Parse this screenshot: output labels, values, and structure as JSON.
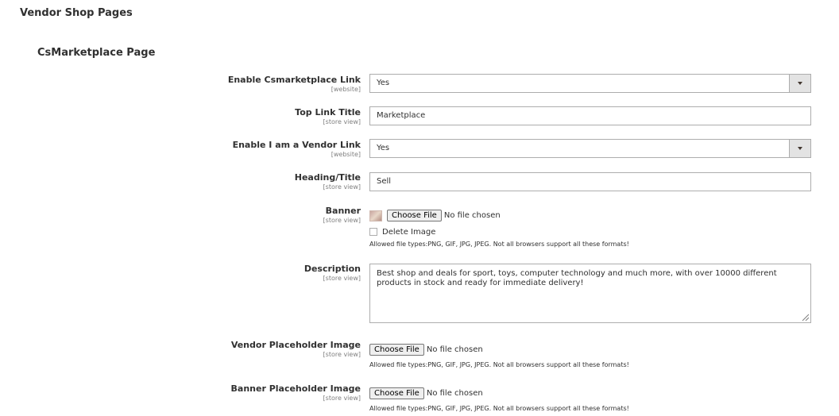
{
  "section_title": "Vendor Shop Pages",
  "group_title": "CsMarketplace Page",
  "fields": {
    "enable_link": {
      "label": "Enable Csmarketplace Link",
      "scope": "[website]",
      "value": "Yes"
    },
    "top_link_title": {
      "label": "Top Link Title",
      "scope": "[store view]",
      "value": "Marketplace"
    },
    "enable_vendor_link": {
      "label": "Enable I am a Vendor Link",
      "scope": "[website]",
      "value": "Yes"
    },
    "heading": {
      "label": "Heading/Title",
      "scope": "[store view]",
      "value": "Sell"
    },
    "banner": {
      "label": "Banner",
      "scope": "[store view]",
      "button": "Choose File",
      "status": "No file chosen",
      "delete_label": "Delete Image",
      "note": "Allowed file types:PNG, GIF, JPG, JPEG. Not all browsers support all these formats!"
    },
    "description": {
      "label": "Description",
      "scope": "[store view]",
      "value": "Best shop and deals for sport, toys, computer technology and much more, with over 10000 different products in stock and ready for immediate delivery!"
    },
    "vendor_placeholder": {
      "label": "Vendor Placeholder Image",
      "scope": "[store view]",
      "button": "Choose File",
      "status": "No file chosen",
      "note": "Allowed file types:PNG, GIF, JPG, JPEG. Not all browsers support all these formats!"
    },
    "banner_placeholder": {
      "label": "Banner Placeholder Image",
      "scope": "[store view]",
      "button": "Choose File",
      "status": "No file chosen",
      "note": "Allowed file types:PNG, GIF, JPG, JPEG. Not all browsers support all these formats!"
    }
  }
}
